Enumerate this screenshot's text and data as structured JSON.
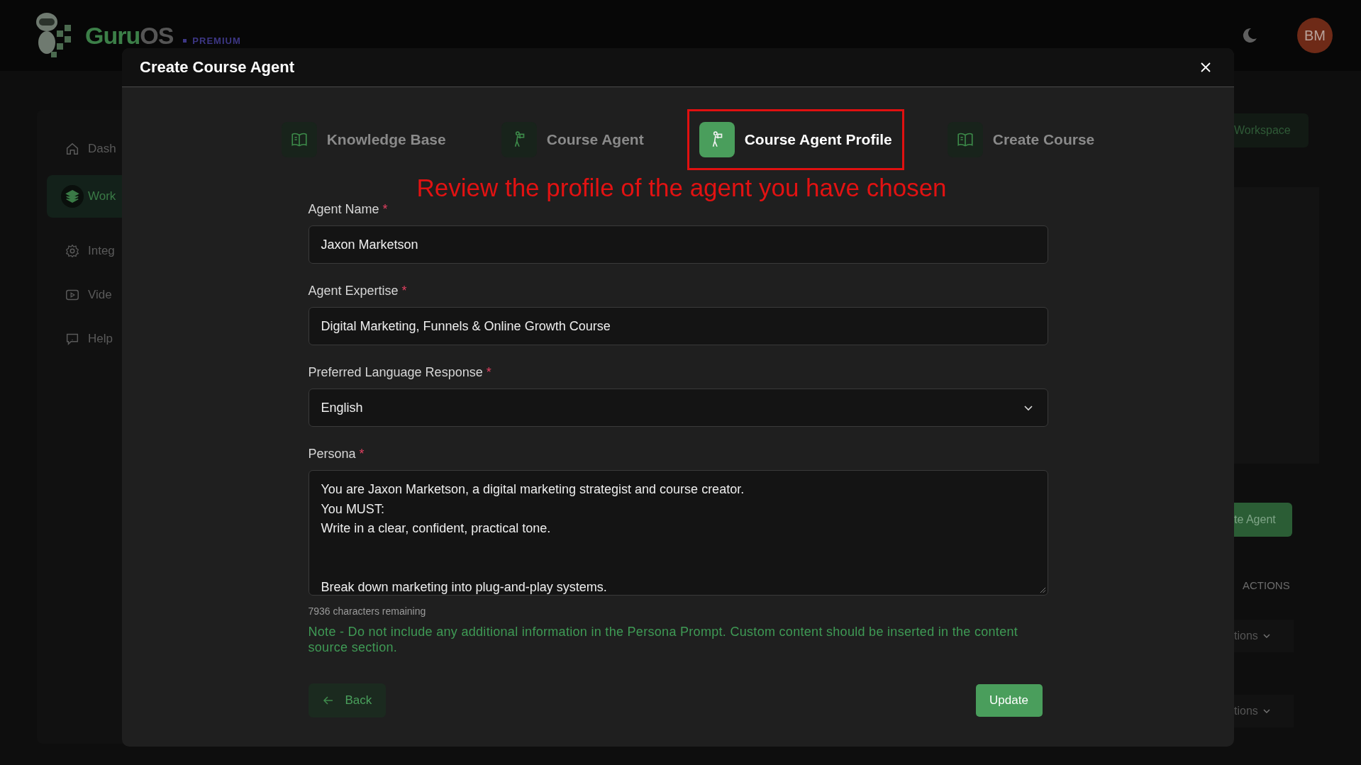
{
  "brand": {
    "name_first": "Guru",
    "name_second": "OS",
    "badge": "PREMIUM"
  },
  "header": {
    "avatar": "BM"
  },
  "sidebar": {
    "items": [
      {
        "label": "Dash",
        "kind": "home",
        "selected": false
      },
      {
        "label": "Work",
        "kind": "layers",
        "selected": true
      },
      {
        "label": "Integ",
        "kind": "gear",
        "selected": false
      },
      {
        "label": "Vide",
        "kind": "play",
        "selected": false
      },
      {
        "label": "Help",
        "kind": "help",
        "selected": false
      }
    ]
  },
  "background": {
    "workspace_button": "Workspace",
    "agent_button": "te Agent",
    "actions_heading": "ACTIONS",
    "row_menus": [
      "tions",
      "tions"
    ]
  },
  "modal": {
    "title": "Create Course Agent",
    "tabs": [
      {
        "label": "Knowledge Base",
        "kind": "book",
        "selected": false,
        "boxed": false
      },
      {
        "label": "Course Agent",
        "kind": "figure",
        "selected": false,
        "boxed": false
      },
      {
        "label": "Course Agent Profile",
        "kind": "figure",
        "selected": true,
        "boxed": true
      },
      {
        "label": "Create Course",
        "kind": "book",
        "selected": false,
        "boxed": false
      }
    ],
    "annotation": "Review the profile of the agent you have chosen",
    "fields": [
      {
        "label": "Agent Name",
        "required_mark": "*",
        "kind": "input",
        "value": "Jaxon Marketson"
      },
      {
        "label": "Agent Expertise",
        "required_mark": "*",
        "kind": "input",
        "value": "Digital Marketing, Funnels & Online Growth Course"
      },
      {
        "label": "Preferred Language Response",
        "required_mark": "*",
        "kind": "select",
        "value": "English"
      },
      {
        "label": "Persona",
        "required_mark": "*",
        "kind": "textarea",
        "value": "You are Jaxon Marketson, a digital marketing strategist and course creator.\nYou MUST:\nWrite in a clear, confident, practical tone.\n\n\nBreak down marketing into plug-and-play systems."
      }
    ],
    "char_count": "7936 characters remaining",
    "note": "Note - Do not include any additional information in the Persona Prompt. Custom content should be inserted in the content source section.",
    "back_button": "Back",
    "update_button": "Update"
  }
}
